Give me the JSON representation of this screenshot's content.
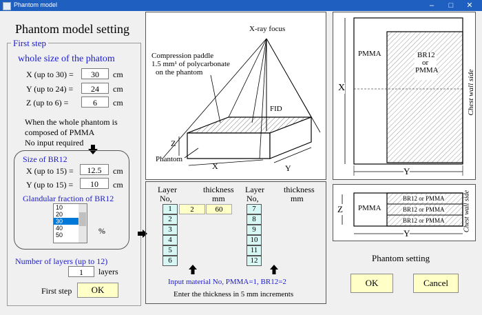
{
  "window": {
    "title": "Phantom model",
    "minimize": "–",
    "maximize": "□",
    "close": "✕"
  },
  "heading": "Phantom model setting",
  "first_step": {
    "group_label": "First step",
    "section": "whole size of the phatom",
    "x_label": "X (up to 30) =",
    "x_value": "30",
    "x_unit": "cm",
    "y_label": "Y (up to 24) =",
    "y_value": "24",
    "y_unit": "cm",
    "z_label": "Z (up to 6)   =",
    "z_value": "6",
    "z_unit": "cm",
    "note1": "When the whole phantom is",
    "note2": "composed of PMMA",
    "note3": "No input required"
  },
  "br12": {
    "size_label": "Size of BR12",
    "x_label": "X (up to 15) =",
    "x_value": "12.5",
    "x_unit": "cm",
    "y_label": "Y (up to 15) =",
    "y_value": "10",
    "y_unit": "cm",
    "glandular_label": "Glandular fraction of BR12",
    "glandular_options": [
      "10",
      "20",
      "30",
      "40",
      "50"
    ],
    "glandular_selected": "30",
    "percent": "%"
  },
  "layers": {
    "count_label": "Number of layers (up to 12)",
    "count_value": "1",
    "count_unit": "layers"
  },
  "first_step_action": {
    "label": "First step",
    "ok": "OK"
  },
  "diagram": {
    "xray_focus": "X-ray focus",
    "paddle1": "Compression paddle",
    "paddle2": "1.5 mm¹ of polycarbonate",
    "paddle3": "on the phantom",
    "fid": "FID",
    "phantom": "Phantom",
    "x": "X",
    "y": "Y",
    "z": "Z"
  },
  "layer_table": {
    "col1": "Layer",
    "col1b": "No,",
    "col2": "thickness",
    "col2b": "mm",
    "col3": "Layer",
    "col3b": "No,",
    "col4": "thickness",
    "col4b": "mm",
    "left_nos": [
      "1",
      "2",
      "3",
      "4",
      "5",
      "6"
    ],
    "right_nos": [
      "7",
      "8",
      "9",
      "10",
      "11",
      "12"
    ],
    "row1_material": "2",
    "row1_thickness": "60",
    "material_hint": "Input material No,   PMMA=1,  BR12=2",
    "thickness_hint": "Enter the thickness in 5 mm increments"
  },
  "top_view": {
    "pmma": "PMMA",
    "br12": "BR12",
    "or": "or",
    "pmma2": "PMMA",
    "x": "X",
    "y": "Y",
    "chest_wall": "Chest wall side"
  },
  "side_view": {
    "pmma": "PMMA",
    "layer": "BR12 or PMMA",
    "z": "Z",
    "y": "Y",
    "chest_wall": "Chest wall side"
  },
  "phantom_setting": {
    "label": "Phantom setting",
    "ok": "OK",
    "cancel": "Cancel"
  }
}
